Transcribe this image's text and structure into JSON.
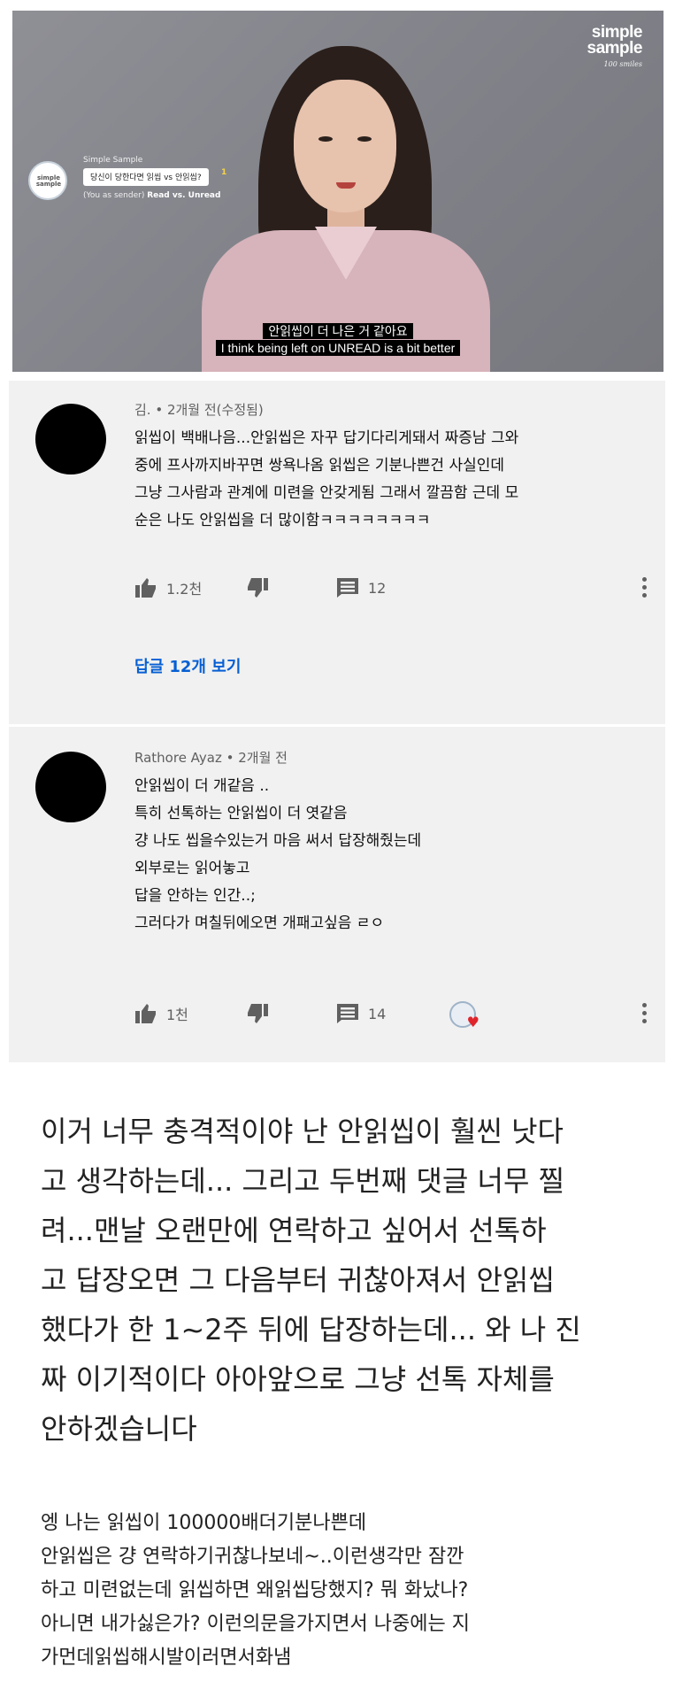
{
  "video": {
    "brand_line1": "simple",
    "brand_line2": "sample",
    "brand_tagline": "100 smiles",
    "channel_logo_text": "simple sample",
    "channel_name": "Simple Sample",
    "question": "당신이 당한다면 읽씹 vs 안읽씹?",
    "badge": "1",
    "sub_prefix": "(You as sender) ",
    "sub_bold": "Read vs. Unread",
    "subtitle_ko": "안읽씹이 더 나은 거 같아요",
    "subtitle_en": "I think being left on UNREAD is a bit better"
  },
  "comments": [
    {
      "author": "김.",
      "time": "2개월 전(수정됨)",
      "lines": [
        "읽씹이 백배나음...안읽씹은 자꾸 답기다리게돼서 짜증남 그와",
        "중에 프사까지바꾸면 쌍욕나옴 읽씹은 기분나쁜건 사실인데",
        "그냥 그사람과 관계에 미련을 안갖게됨 그래서 깔끔함 근데 모",
        "순은 나도 안읽씹을 더 많이함ㅋㅋㅋㅋㅋㅋㅋㅋ"
      ],
      "likes": "1.2천",
      "reply_count": "12",
      "view_replies": "답글 12개 보기"
    },
    {
      "author": "Rathore Ayaz",
      "time": "2개월 전",
      "lines": [
        "안읽씹이 더 개같음 ..",
        "특히 선톡하는 안읽씹이 더 엿같음",
        "걍 나도 씹을수있는거 마음 써서 답장해줬는데",
        "외부로는 읽어놓고",
        "답을 안하는 인간..;",
        "그러다가 며칠뒤에오면 개패고싶음 ㄹㅇ"
      ],
      "likes": "1천",
      "reply_count": "14"
    }
  ],
  "post": {
    "main_lines": [
      "이거 너무 충격적이야 난 안읽씹이 훨씬 낫다",
      "고 생각하는데... 그리고 두번째 댓글 너무 찔",
      "려...맨날 오랜만에 연락하고 싶어서 선톡하",
      "고 답장오면 그 다음부터 귀찮아져서 안읽씹",
      "했다가 한 1~2주 뒤에 답장하는데... 와 나 진",
      "짜 이기적이다 아아앞으로 그냥 선톡 자체를",
      "안하겠습니다"
    ],
    "reply_lines": [
      "엥 나는 읽씹이 100000배더기분나쁜데",
      "안읽씹은 걍 연락하기귀찮나보네~..이런생각만 잠깐",
      "하고 미련없는데 읽씹하면 왜읽씹당했지? 뭐 화났나?",
      "아니면 내가싫은가? 이런의문을가지면서 나중에는 지",
      "가먼데읽씹해시발이러면서화냄"
    ]
  },
  "colors": {
    "link_blue": "#065fd4",
    "meta_gray": "#606060",
    "heart_red": "#e0242c"
  },
  "icons": [
    "like-icon",
    "dislike-icon",
    "comment-icon",
    "more-icon",
    "creator-heart-icon"
  ]
}
